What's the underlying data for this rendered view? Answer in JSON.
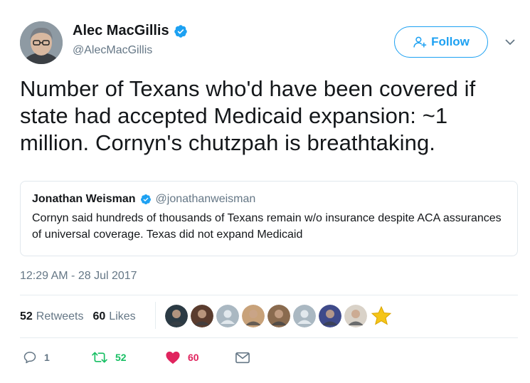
{
  "tweet": {
    "author_name": "Alec MacGillis",
    "author_handle": "@AlecMacGillis",
    "follow_label": "Follow",
    "text": "Number of Texans who'd have been covered if state had accepted Medicaid expansion: ~1 million. Cornyn's chutzpah is breathtaking.",
    "timestamp": "12:29 AM - 28 Jul 2017"
  },
  "quoted": {
    "author_name": "Jonathan Weisman",
    "author_handle": "@jonathanweisman",
    "text": "Cornyn said hundreds of thousands of Texans remain w/o insurance despite ACA assurances of universal coverage. Texas did not expand Medicaid"
  },
  "stats": {
    "retweets_count": "52",
    "retweets_label": "Retweets",
    "likes_count": "60",
    "likes_label": "Likes"
  },
  "likers": [
    {
      "icon": "avatar",
      "color": "#2b3a44"
    },
    {
      "icon": "avatar",
      "color": "#5a3c2e"
    },
    {
      "icon": "default-avatar",
      "color": "#aab8c2"
    },
    {
      "icon": "avatar",
      "color": "#c8a27a"
    },
    {
      "icon": "avatar",
      "color": "#8a6b4f"
    },
    {
      "icon": "default-avatar",
      "color": "#aab8c2"
    },
    {
      "icon": "avatar",
      "color": "#3f4a8a"
    },
    {
      "icon": "avatar",
      "color": "#d9d2c8"
    },
    {
      "icon": "star-avatar",
      "color": "#f5c518"
    }
  ],
  "actions": {
    "reply_count": "1",
    "retweet_count": "52",
    "like_count": "60"
  },
  "colors": {
    "accent": "#1da1f2",
    "retweet": "#17bf63",
    "like": "#e0245e",
    "muted": "#657786"
  }
}
